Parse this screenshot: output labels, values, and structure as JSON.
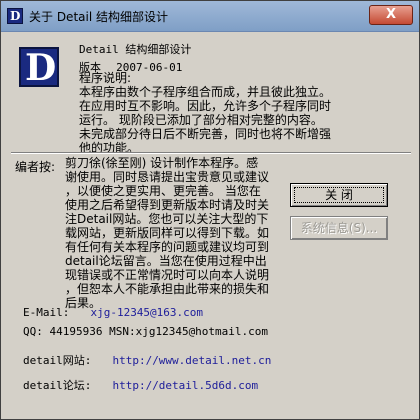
{
  "window": {
    "title": "关于 Detail 结构细部设计",
    "close_glyph": "X"
  },
  "logo_letter": "D",
  "product_name": "Detail 结构细部设计",
  "version_label": "版本",
  "version_value": "2007-06-01",
  "program_desc": {
    "heading": "程序说明:",
    "lines": [
      "本程序由数个子程序组合而成，并且彼此独立。",
      "在应用时互不影响。因此，允许多个子程序同时",
      "运行。    现阶段已添加了部分相对完整的内容。",
      "未完成部分待日后不断完善，同时也将不断增强",
      "他的功能。"
    ]
  },
  "editor": {
    "label": "编者按:",
    "lines": [
      "剪刀徐(徐至刚) 设计制作本程序。感",
      "谢使用。同时恳请提出宝贵意见或建议",
      "，以便使之更实用、更完善。    当您在",
      "使用之后希望得到更新版本时请及时关",
      "注Detail网站。您也可以关注大型的下",
      "载网站，更新版同样可以得到下载。如",
      "有任何有关本程序的问题或建议均可到",
      "detail论坛留言。当您在使用过程中出",
      "现错误或不正常情况时可以向本人说明",
      "，但恕本人不能承担由此带来的损失和",
      "后果。"
    ]
  },
  "buttons": {
    "close_label": "关 闭",
    "sysinfo_label": "系统信息(S)..."
  },
  "contact": {
    "email_label": "E-Mail:",
    "email_value": "xjg-12345@163.com",
    "qq_line": "QQ: 44195936  MSN:xjg12345@hotmail.com",
    "site_label": "detail网站:",
    "site_url": "http://www.detail.net.cn",
    "forum_label": "detail论坛:",
    "forum_url": "http://detail.5d6d.com"
  }
}
